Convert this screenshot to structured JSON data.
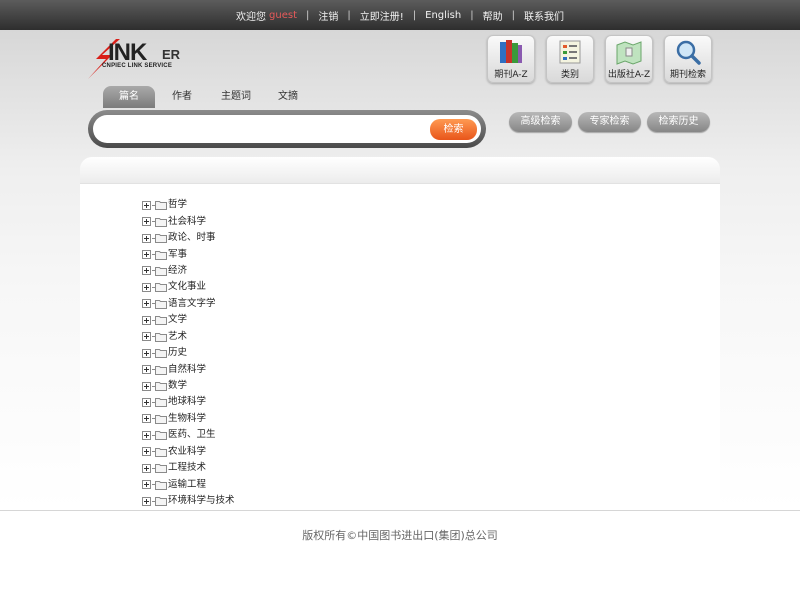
{
  "topbar": {
    "welcome": "欢迎您",
    "user": "guest",
    "logout": "注销",
    "register": "立即注册!",
    "english": "English",
    "help": "帮助",
    "contact": "联系我们"
  },
  "logo": {
    "brand": "INK",
    "brand_suffix": "ER",
    "tagline": "CNPIEC LINK SERVICE"
  },
  "icon_buttons": [
    {
      "label": "期刊A-Z",
      "icon": "books-icon"
    },
    {
      "label": "类别",
      "icon": "category-icon"
    },
    {
      "label": "出版社A-Z",
      "icon": "map-icon"
    },
    {
      "label": "期刊检索",
      "icon": "magnifier-icon"
    }
  ],
  "search": {
    "tabs": [
      "篇名",
      "作者",
      "主题词",
      "文摘"
    ],
    "active_tab": "篇名",
    "value": "",
    "button": "检索"
  },
  "pills": [
    "高级检索",
    "专家检索",
    "检索历史"
  ],
  "categories": [
    "哲学",
    "社会科学",
    "政论、时事",
    "军事",
    "经济",
    "文化事业",
    "语言文字学",
    "文学",
    "艺术",
    "历史",
    "自然科学",
    "数学",
    "地球科学",
    "生物科学",
    "医药、卫生",
    "农业科学",
    "工程技术",
    "运输工程",
    "环境科学与技术"
  ],
  "footer": "版权所有©中国图书进出口(集团)总公司",
  "colors": {
    "accent_orange": "#e8551a",
    "topbar": "#3a3a3a",
    "guest": "#e85a5a"
  }
}
